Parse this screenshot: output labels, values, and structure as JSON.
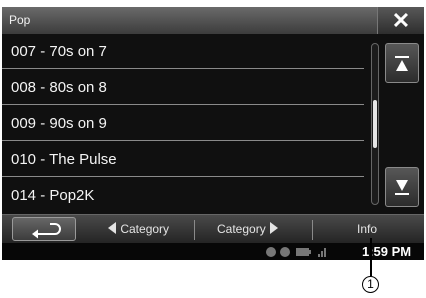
{
  "header": {
    "title": "Pop"
  },
  "stations": [
    {
      "label": "007 - 70s on 7"
    },
    {
      "label": "008 - 80s on 8"
    },
    {
      "label": "009 - 90s on 9"
    },
    {
      "label": "010 - The Pulse"
    },
    {
      "label": "014 - Pop2K"
    }
  ],
  "bottom_bar": {
    "prev_category_label": "Category",
    "next_category_label": "Category",
    "info_label": "Info"
  },
  "status": {
    "time": "1:59 PM"
  },
  "callout": {
    "number": "1"
  },
  "scrollbar": {
    "position": 0.5,
    "visible_fraction": 0.3
  },
  "icons": {
    "close": "close-icon",
    "back": "back-arrow-icon",
    "scroll_up": "scroll-up-icon",
    "scroll_down": "scroll-down-icon",
    "prev_category": "triangle-left-icon",
    "next_category": "triangle-right-icon"
  }
}
